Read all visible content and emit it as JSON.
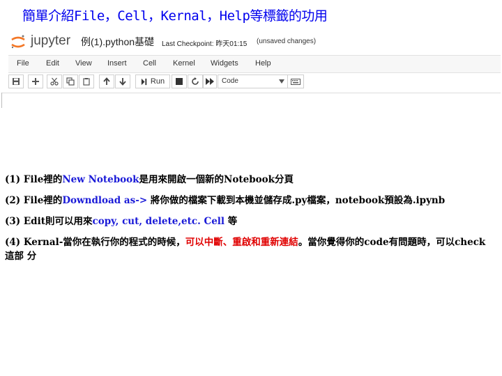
{
  "title": "簡單介紹File，Cell，Kernal，Help等標籤的功用",
  "jupyter": {
    "wordmark": "jupyter",
    "notebook_name": "例(1).python基礎",
    "checkpoint": "Last Checkpoint: 昨天01:15",
    "unsaved": "(unsaved changes)"
  },
  "menu": [
    "File",
    "Edit",
    "View",
    "Insert",
    "Cell",
    "Kernel",
    "Widgets",
    "Help"
  ],
  "toolbar": {
    "run_label": "Run",
    "cell_type": "Code",
    "icons": [
      "save-icon",
      "plus-icon",
      "cut-icon",
      "copy-icon",
      "paste-icon",
      "arrow-up-icon",
      "arrow-down-icon",
      "run-icon",
      "stop-icon",
      "restart-icon",
      "fast-forward-icon",
      "keyboard-icon"
    ]
  },
  "paragraphs": [
    {
      "segments": [
        {
          "text": "(1) File裡的",
          "style": "plain"
        },
        {
          "text": "New Notebook",
          "style": "blue"
        },
        {
          "text": "是用來開啟一個新的Notebook分頁",
          "style": "plain"
        }
      ]
    },
    {
      "segments": [
        {
          "text": "(2) File裡的",
          "style": "plain"
        },
        {
          "text": "Downdload as->",
          "style": "blue"
        },
        {
          "text": " 將你做的檔案下載到本機並儲存成.py檔案，notebook預設為.ipynb",
          "style": "plain"
        }
      ]
    },
    {
      "segments": [
        {
          "text": "(3) Edit則可以用來",
          "style": "plain"
        },
        {
          "text": "copy, cut, delete,etc. Cell",
          "style": "blue"
        },
        {
          "text": " 等",
          "style": "plain"
        }
      ]
    },
    {
      "segments": [
        {
          "text": "(4) Kernal-當你在執行你的程式的時候，",
          "style": "plain"
        },
        {
          "text": "可以中斷、重啟和重新連結",
          "style": "red"
        },
        {
          "text": "。當你覺得你的code有問題時，可以check這部 分",
          "style": "plain"
        }
      ]
    }
  ],
  "colors": {
    "title": "#0000ee",
    "accent_blue": "#1a1ad8",
    "accent_red": "#e00000",
    "logo_orange": "#f37726"
  }
}
